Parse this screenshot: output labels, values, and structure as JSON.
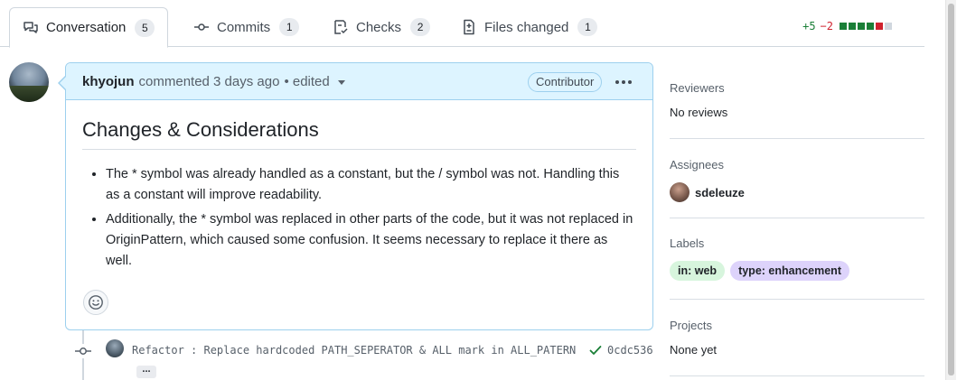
{
  "tabs": [
    {
      "label": "Conversation",
      "count": "5",
      "icon": "comment-discussion-icon"
    },
    {
      "label": "Commits",
      "count": "1",
      "icon": "git-commit-icon"
    },
    {
      "label": "Checks",
      "count": "2",
      "icon": "checklist-icon"
    },
    {
      "label": "Files changed",
      "count": "1",
      "icon": "file-diff-icon"
    }
  ],
  "diffstat": {
    "additions": "+5",
    "deletions": "−2",
    "colors": {
      "add": "#1a7f37",
      "del": "#cf222e",
      "neutral": "#d0d7de"
    },
    "blocks": [
      "add",
      "add",
      "add",
      "add",
      "del",
      "neutral"
    ]
  },
  "comment": {
    "author": "khyojun",
    "action": "commented 3 days ago",
    "edited": "• edited",
    "badge": "Contributor",
    "heading": "Changes & Considerations",
    "bullets": [
      "The * symbol was already handled as a constant, but the / symbol was not. Handling this as a constant will improve readability.",
      "Additionally, the * symbol was replaced in other parts of the code, but it was not replaced in OriginPattern, which caused some confusion. It seems necessary to replace it there as well."
    ]
  },
  "commit": {
    "message": "Refactor : Replace hardcoded PATH_SEPERATOR & ALL mark in ALL_PATERN",
    "sha": "0cdc536",
    "more": "..."
  },
  "sidebar": {
    "reviewers": {
      "title": "Reviewers",
      "value": "No reviews"
    },
    "assignees": {
      "title": "Assignees",
      "user": "sdeleuze"
    },
    "labels": {
      "title": "Labels",
      "items": [
        {
          "name": "in: web",
          "bg": "#d7f5dd",
          "fg": "#1f2328"
        },
        {
          "name": "type: enhancement",
          "bg": "#ddd3fb",
          "fg": "#1f2328"
        }
      ]
    },
    "projects": {
      "title": "Projects",
      "value": "None yet"
    }
  }
}
